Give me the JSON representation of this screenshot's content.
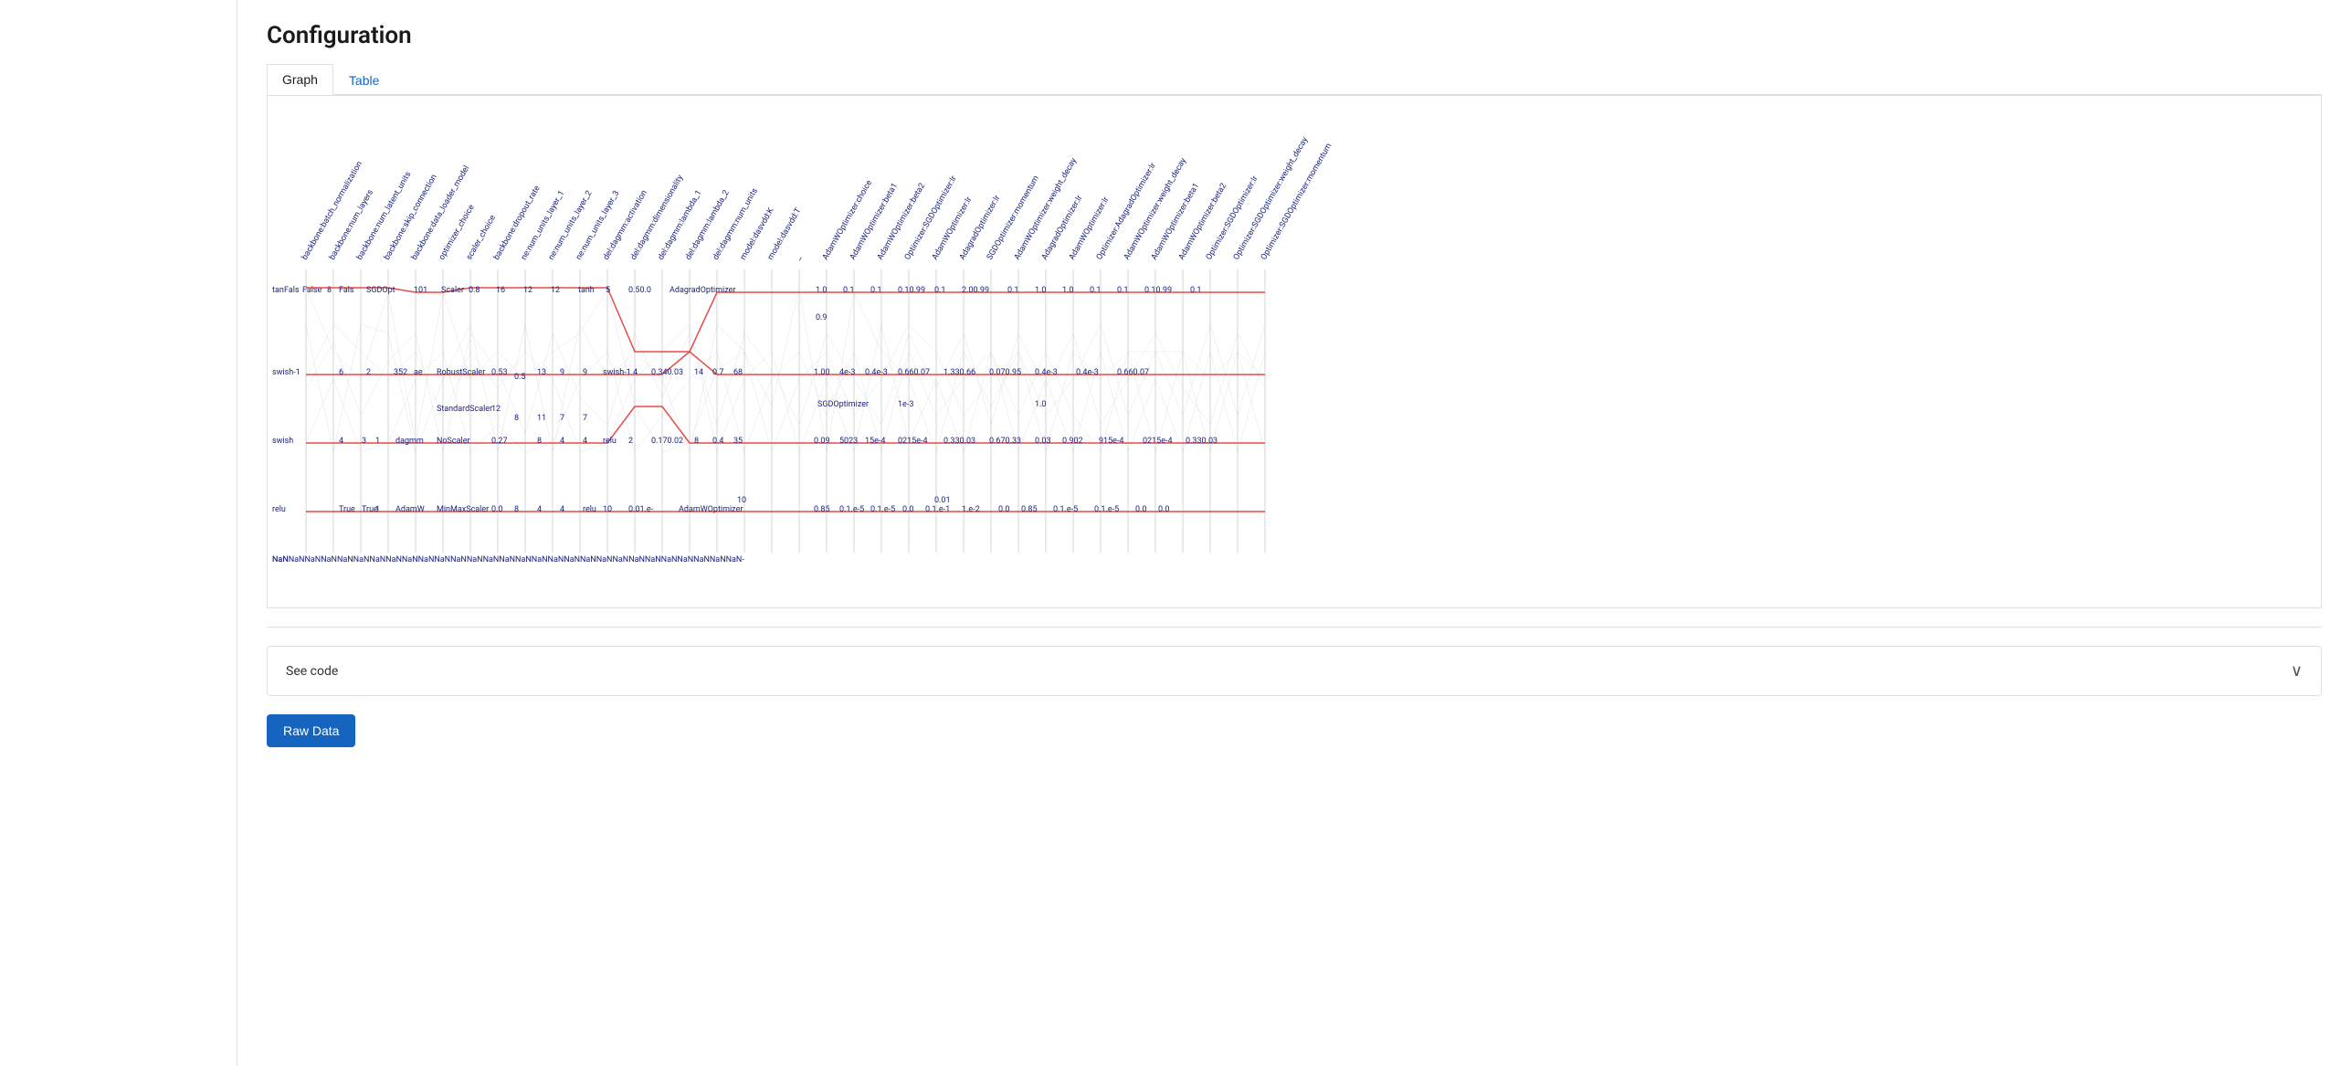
{
  "page": {
    "title": "Configuration"
  },
  "tabs": [
    {
      "id": "graph",
      "label": "Graph",
      "active": true,
      "blue": false
    },
    {
      "id": "table",
      "label": "Table",
      "active": false,
      "blue": true
    }
  ],
  "graph": {
    "axis_labels": [
      "backbone:batch_normalization",
      "backbone:num_layers",
      "backbone:num_latent_units",
      "backbone:skip_connection",
      "backbone:data_loader_model",
      "optimizer_choice",
      "scaler_choice",
      "backbone:dropout_rate",
      "ne:num_units_layer_1",
      "ne:num_units_layer_2",
      "ne:num_units_layer_3",
      "del:dagmm:activation",
      "del:dagmm:dimensionality",
      "del:dagmm:lambda_1",
      "del:dagmm:lambda_2",
      "del:dagmm:num_units",
      "model:dasvdd:K",
      "model:dasvdd:T",
      "_",
      "AdamWOptimizer:choice",
      "AdamWOptimizer:beta1",
      "AdamWOptimizer:beta2",
      "Optimizer:SGDOptimizer:lr",
      "AdamWOptimizer:lr",
      "AdagradOptimizer:lr",
      "SGDOptimizer:momentum",
      "AdamWOptimizer:weight_decay",
      "AdagradOptimizer:lr",
      "AdamWOptimizer:lr",
      "Optimizer:AdagradOptimizer:lr",
      "AdamWOptimizer:weight_decay",
      "AdamWOptimizer:beta1",
      "AdamWOptimizer:beta2",
      "Optimizer:SGDOptimizer:lr",
      "Optimizer:SGDOptimizer:weight_decay",
      "Optimizer:SGDOptimizer:momentum"
    ],
    "value_rows": [
      {
        "label": "tan/Fals/False/8/Fals/SGDOpt/101/Scaler/0.8/16/12/12/tanh/5/0.50.0/AdagradOptimizer/1.0/0.1/0.1/0.10.99/0.1/2.00.99/0.1/1.0/1.0/0.1/0.1/0.10.99/0.1"
      },
      {
        "label": "swish-1/6/2/352/ae/RobustScaler/0.53/0.5/13/9/swish-1/4/0.340.03/14/0.7/68/1.004e-30.4e-30.660.071.330.660.070.950.4e-30.4e-30.660.07"
      },
      {
        "label": "swish/4/3/1/dagmm/StandardScaler/0.27/12/11/8/7/swish/2/0.170.02/8/0.4/35/0.09502315e-40215e-40.330.030.670.330.03/0.902915e-40215e-40.330.03"
      },
      {
        "label": "swish/4/3/1/dagmm/NoScaler/0.27"
      },
      {
        "label": "relu/True/True/1/AdamW/MinMaxScaler/0.0/8/4/4/relu/10/0.01.e-/AdamWOptimizer/0.85/0.1.e-5/0.1.e-5/0.0/0.1.e-1/1.e-2/0.00.85/0.1.e-5/0.1.e-5/0.0/0.0"
      },
      {
        "label": "NaNNaNNaNNaNNaNNaNNaNNaNNaNNaNNaNNaNNaNNaNNaNNaNNaNNaNNaNNaNNaNNaNNaNNaNNaNNaNNaNNaNNaNNaNNaNNaN-"
      }
    ]
  },
  "see_code": {
    "label": "See code",
    "chevron": "∨"
  },
  "buttons": {
    "raw_data": "Raw Data"
  }
}
